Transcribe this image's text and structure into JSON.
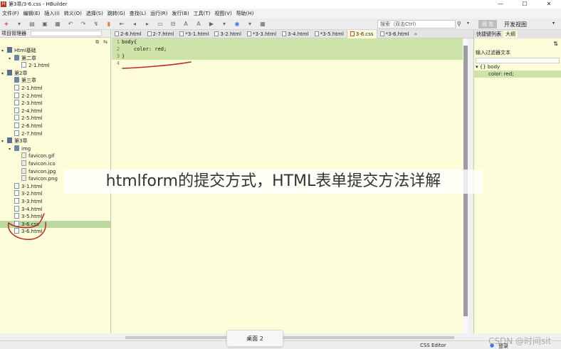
{
  "window": {
    "title": "第3章/3-6.css - HBuilder",
    "app_icon": "H",
    "minimize": "—",
    "maximize": "☐",
    "close": "✕"
  },
  "menu": [
    "文件(F)",
    "编辑(E)",
    "插入(I)",
    "转义(O)",
    "选择(S)",
    "跳转(G)",
    "查找(L)",
    "运行(R)",
    "发行(B)",
    "工具(T)",
    "视图(V)",
    "帮助(H)"
  ],
  "toolbar": {
    "search_placeholder": "搜索（双击Ctrl)",
    "view_button": "阅 览",
    "view_mode": "开发视图"
  },
  "project_panel": {
    "title": "项目管理器",
    "tree": [
      {
        "label": "Html基础",
        "kind": "proj",
        "level": 0,
        "expand": "▾"
      },
      {
        "label": "第二章",
        "kind": "folder",
        "level": 1,
        "expand": "▾"
      },
      {
        "label": "2-1.html",
        "kind": "file",
        "level": 2,
        "expand": ""
      },
      {
        "label": "第2章",
        "kind": "proj",
        "level": 0,
        "expand": "▾"
      },
      {
        "label": "第三章",
        "kind": "folder",
        "level": 1,
        "expand": ""
      },
      {
        "label": "2-1.html",
        "kind": "file",
        "level": 1,
        "expand": ""
      },
      {
        "label": "2-2.html",
        "kind": "file",
        "level": 1,
        "expand": ""
      },
      {
        "label": "2-3.html",
        "kind": "file",
        "level": 1,
        "expand": ""
      },
      {
        "label": "2-4.html",
        "kind": "file",
        "level": 1,
        "expand": ""
      },
      {
        "label": "2-5.html",
        "kind": "file",
        "level": 1,
        "expand": ""
      },
      {
        "label": "2-6.html",
        "kind": "file",
        "level": 1,
        "expand": ""
      },
      {
        "label": "2-7.html",
        "kind": "file",
        "level": 1,
        "expand": ""
      },
      {
        "label": "第3章",
        "kind": "proj",
        "level": 0,
        "expand": "▾"
      },
      {
        "label": "img",
        "kind": "folder",
        "level": 1,
        "expand": "▾"
      },
      {
        "label": "favicon.gif",
        "kind": "img",
        "level": 2,
        "expand": ""
      },
      {
        "label": "favicon.ico",
        "kind": "img",
        "level": 2,
        "expand": ""
      },
      {
        "label": "favicon.jpg",
        "kind": "img",
        "level": 2,
        "expand": ""
      },
      {
        "label": "favicon.png",
        "kind": "img",
        "level": 2,
        "expand": ""
      },
      {
        "label": "3-1.html",
        "kind": "file",
        "level": 1,
        "expand": ""
      },
      {
        "label": "3-2.html",
        "kind": "file",
        "level": 1,
        "expand": ""
      },
      {
        "label": "3-3.html",
        "kind": "file",
        "level": 1,
        "expand": ""
      },
      {
        "label": "3-4.html",
        "kind": "file",
        "level": 1,
        "expand": ""
      },
      {
        "label": "3-5.html",
        "kind": "file",
        "level": 1,
        "expand": ""
      },
      {
        "label": "3-6.css",
        "kind": "file",
        "level": 1,
        "expand": "",
        "selected": true
      },
      {
        "label": "3-6.html",
        "kind": "file",
        "level": 1,
        "expand": ""
      }
    ]
  },
  "tabs": [
    "2-6.html",
    "2-7.html",
    "*3-1.html",
    "3-2.html",
    "*3-3.html",
    "3-4.html",
    "*3-5.html",
    "3-6.css",
    "*3-6.html"
  ],
  "active_tab": "3-6.css",
  "tabs_more": "»",
  "editor": {
    "lines": [
      {
        "n": "1",
        "text": "body{"
      },
      {
        "n": "2",
        "text": "    color: red;"
      },
      {
        "n": "3",
        "text": "}"
      },
      {
        "n": "4",
        "text": ""
      }
    ]
  },
  "outline_panel": {
    "tabs": [
      "快捷键列表",
      "大纲"
    ],
    "filter_label": "输入过滤器文本",
    "items": [
      {
        "label": "{} body",
        "expand": "▾"
      },
      {
        "label": "color: red;",
        "expand": ""
      }
    ]
  },
  "status": {
    "mode": "CSS Editor",
    "login": "登录"
  },
  "taskbar": {
    "desktop_label": "桌面 2"
  },
  "overlay": {
    "caption": "htmlform的提交方式，HTML表单提交方法详解",
    "watermark": "CSDN @时间sit"
  }
}
